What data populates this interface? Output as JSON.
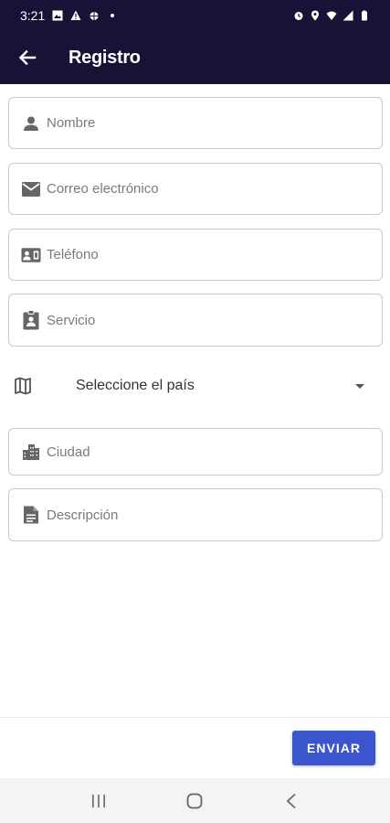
{
  "status_bar": {
    "time": "3:21",
    "left_icons": [
      "image-icon",
      "warning-icon",
      "bug-icon",
      "dot-icon"
    ],
    "right_icons": [
      "alarm-icon",
      "location-icon",
      "wifi-icon",
      "signal-icon",
      "battery-icon"
    ]
  },
  "app_bar": {
    "title": "Registro",
    "back_icon": "arrow-left-icon",
    "background": "#1a1136"
  },
  "form": {
    "fields": [
      {
        "icon": "person-icon",
        "placeholder": "Nombre"
      },
      {
        "icon": "mail-icon",
        "placeholder": "Correo electrónico"
      },
      {
        "icon": "contact-phone-icon",
        "placeholder": "Teléfono"
      },
      {
        "icon": "badge-icon",
        "placeholder": "Servicio"
      }
    ],
    "country_select": {
      "icon": "map-icon",
      "value": "Seleccione el país"
    },
    "fields_after": [
      {
        "icon": "city-icon",
        "placeholder": "Ciudad"
      },
      {
        "icon": "document-icon",
        "placeholder": "Descripción"
      }
    ]
  },
  "submit": {
    "label": "ENVIAR",
    "color": "#3b55cf"
  },
  "nav_bar": {
    "buttons": [
      "recents-button",
      "home-button",
      "back-button"
    ]
  }
}
